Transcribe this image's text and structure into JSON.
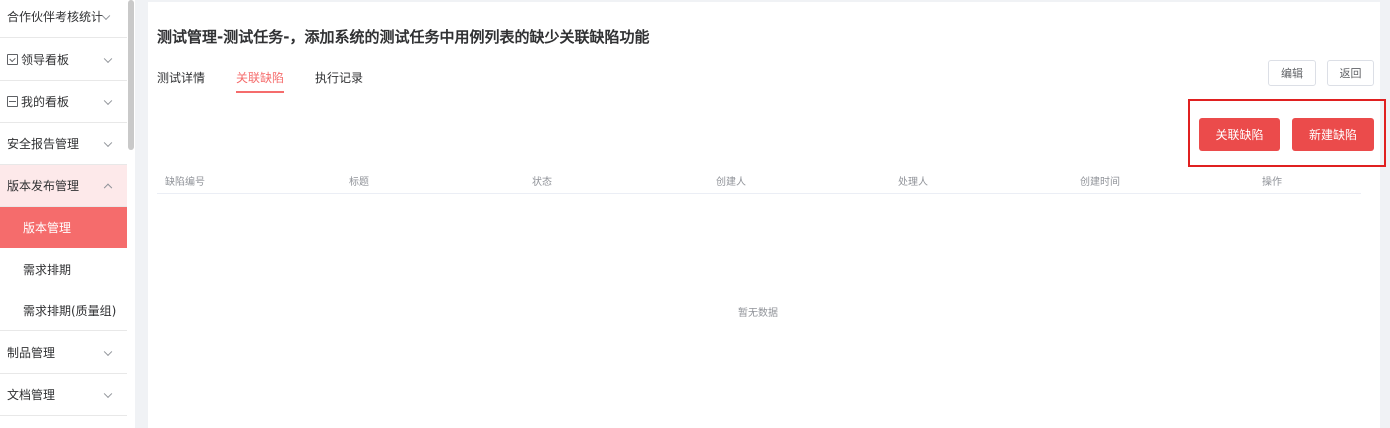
{
  "sidebar": {
    "items": [
      {
        "label": "合作伙伴考核统计",
        "icon": "",
        "expanded": false
      },
      {
        "label": "领导看板",
        "icon": "board-icon",
        "expanded": false
      },
      {
        "label": "我的看板",
        "icon": "mine-board-icon",
        "expanded": false
      },
      {
        "label": "安全报告管理",
        "icon": "",
        "expanded": false
      },
      {
        "label": "版本发布管理",
        "icon": "",
        "expanded": true
      },
      {
        "label": "制品管理",
        "icon": "",
        "expanded": false
      },
      {
        "label": "文档管理",
        "icon": "",
        "expanded": false
      }
    ],
    "sub_items": [
      {
        "label": "版本管理",
        "active": true
      },
      {
        "label": "需求排期",
        "active": false
      },
      {
        "label": "需求排期(质量组)",
        "active": false
      }
    ]
  },
  "page": {
    "title": "测试管理-测试任务-，添加系统的测试任务中用例列表的缺少关联缺陷功能"
  },
  "tabs": [
    {
      "label": "测试详情",
      "active": false
    },
    {
      "label": "关联缺陷",
      "active": true
    },
    {
      "label": "执行记录",
      "active": false
    }
  ],
  "toolbar": {
    "edit_label": "编辑",
    "back_label": "返回",
    "link_defect_label": "关联缺陷",
    "new_defect_label": "新建缺陷"
  },
  "table": {
    "columns": [
      "缺陷编号",
      "标题",
      "状态",
      "创建人",
      "处理人",
      "创建时间",
      "操作"
    ],
    "rows": [],
    "empty_text": "暂无数据"
  },
  "colors": {
    "accent": "#f56c6c",
    "primary_button": "#eb4b4b",
    "highlight_border": "#e02020"
  }
}
